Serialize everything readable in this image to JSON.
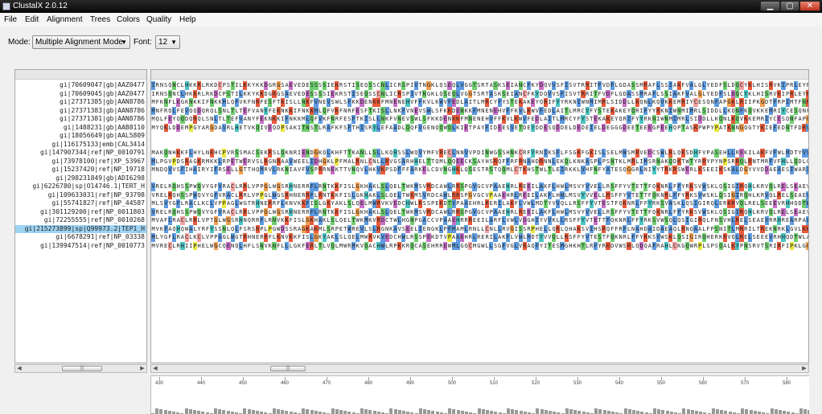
{
  "window": {
    "title": "ClustalX 2.0.12",
    "minimize": "▁",
    "maximize": "▢",
    "close": "✕"
  },
  "menu": [
    "File",
    "Edit",
    "Alignment",
    "Trees",
    "Colors",
    "Quality",
    "Help"
  ],
  "toolbar": {
    "mode_label": "Mode:",
    "mode_value": "Multiple Alignment Mode",
    "font_label": "Font:",
    "font_value": "12"
  },
  "sequence_names": [
    "gi|70609047|gb|AAZ0477",
    "gi|70609045|gb|AAZ0477",
    "gi|27371385|gb|AAN8786",
    "gi|27371383|gb|AAN8786",
    "gi|27371381|gb|AAN8786",
    "gi|1488231|gb|AAB8110",
    "gi|18056649|gb|AAL5809",
    "gi|116175133|emb|CAL3414",
    "gi|147907344|ref|NP_0010791",
    "gi|73978100|ref|XP_53967",
    "gi|15237420|ref|NP_19718",
    "gi|298231849|gb|ADI6298",
    "gi|6226780|sp|O14746.1|TERT_H",
    "gi|109633031|ref|NP_93798",
    "gi|55741827|ref|NP_44587",
    "gi|301129200|ref|NP_0011803",
    "gi|72255555|ref|NP_0010268",
    "gi|215273899|sp|Q99973.2|TEP1_H",
    "gi|6678291|ref|NP_03338",
    "gi|139947514|ref|NP_0010773"
  ],
  "selected_row": 17,
  "sequences": [
    "IRNSQNCLHKKRLRKDCPSTILKKYKKDGRGSAEVEDESSSSIEKRSTISEQSSCNLICRSPIVTNGKLQSEQLVGGTSRTASKSEIANCFKYDQVVSFISVTRRITFVDFLGDASSMRAFLSSIAKFVALGLYEDFSLDQCYKLHISRVKIPRLEYRAKHHSYLGRSQAIVNP",
    "IRNSQNCLHKKRLRKDCPSTILKKYKKDGRGSAEVEDESSSSIEKRSTISEQSSCNLICRSPIVTNGKLQSEQLVGGTSRTASKSEIANCFKYDQVVSFISVTRRITFVDFLGDASSMRAFLSSIAKFVALGLYEDFSLDQCYKLHISRVKIPRLEYRAKHHSYLGRSQAIVNP",
    "MFKNFLEGKNKKIFNKKMLQFVKFNRFESFTKISLLNKFVNEVSWLSFKKDENKKFMNENEHVFFKVLKWVFEDLAITLMRCYFYSTEKAKEYQRIFYYRKNIWNMIMRLSIDDLLKQNLKQVKKEMRIYCESQNFAPGKLRIIPKGDTFRPIMTFNRKIVNSDRKTTKLTT",
    "MNFRQLFEVQQDQRQLSNLTLTEFVANYFEKNKKIFNKKMLQFVKFNRFESFTKISLLNKFVNEVSWLSFKKDENKKFMNENEHVFFKVLKWVFEDLAITLMRCYFYSTEKAKEYQRIFYYRKNIWNMIMRLSIDDLLKQNFKQVKKEMRIYCESQNFAPGKLRIIPKGDTF",
    "MQLFEYQQDQRQLSNLTLTEFVANYFEKNKKIFNKKMLQFVKFNRFESFTKISLLNKFVNEVSWLSFKKDENKKFMNENEHVFFKVLKWVFEDLAITLMRCYFYSTEKAKEYQRIFYYRKNIWNMIMRLSIDDLLKQNLKQVKKEMRIYCESQNFAPGKLRIIPKGDTFRPIM",
    "MYQKLDDEMPGYARGDAVRLHETVKQIVEQDPSAKITNSTLRAFKFSFTHISRYLEFAADLQQFVGENQQWQLKIETPAYFIDEESVETDEYDDESQDDELDEDEIELDEGGGDEETEEEGPEEHQPTASKPWPYPATKNNGQGTYKIEFEDNTFDRVHKFLIFPLLVRAIV",
    "",
    "",
    "MAKQNHKKFLHYLNKHCPVRSSMACSEKRSLQKNRIENDGKQLKHFTTKANLLSLLKQHSSLWQVYMFVRECLNNVVPDINWGSSHNKCRFYRNIKSFLFSGKFGKISLSELMWSMRVEDCSWLRLQKSDHFVPASEHLLREKILAKFVFWLMDTYVVELLRSFFYITETTF",
    "MLPGVPDSRAGKRMKKLRPETWERVSLRGNRAAVWEELIDHGKLPFMALRNLCNLLRVGSARHHELTTQMLQQEECKSAYHSRQFFRFRNAHDRNNLEKQLKNKASPLPSNTKLMRLIMSRNAKQDKTWTYRRYPYNPSRRQLRNTMRFVFHLLQDLGYLLEAVLH",
    "MNDQVVSFIHAIRYIFRSELLGTTHQMRVLRKNIAVFVSPRRNEKTTVNQVLHKVKPSDFFFARKELCDVNGHKLQSESTRSTQQMLCTKHSTWLTLEIRKKLVHFNFYATESQGGRLNIYYTRKRSWERLKSEEIKSKALDGYVVDDAEAESIWARIEGGV",
    "",
    "VRELRQHSSPWQVYGFVRACLRRLVPPGLWGSRHNERRFLRNTKKFISLGKHAKLSLQELTWKMSVRDCAWLRRSPGVGCVPAAEHRLREEILAKFLHWLMSVYVVELLRSFFYVTETTFQKNRLFFYRKSVWSKLQSIGIRQHLKRVQLRELSEAEVRQHREARPALLTS",
    "VRELRQHSSPWQVYGFVRACLRRLVPPGLWGSRHNERRFLRNTKKFISLGKHAKLSLQELTWKMSVRDCAWLRRSPGVGCVPAAEHRLREEILAKFLHWLMSVYVVELLRSFFYVTETTFQKNRLFFYRKSVWSKLQSIGIRQHLKRVQLRELSEAEVRQHREARPALLTS",
    "MLSVYGFLRACLKCLVPPAGLWGTRHNERRFLKNVKKFISLGKYAKLSLQELMWRVKVEDCHWLRSSPEKDTVPAAEHRLRERILAKFLVWLMDTYVVQLLRSFFYVTESTFQKNRLFFYRKSVWSKLQSIGIRQLERKRVQLRELSEEEVRHHQDTWLAMPICRL",
    "VRELRQHSSPWQVYGFVRACLRRLVPPGLWGSRHNERRFLRNTKKFISLGKHAKLSLQELTWKMSVRDCAWLRRSPGVGCVPAAEHRLREEILAKFLHWLMSVYVVELLRSFFYVTETTFQKNRLFFYRKSVWSKLQSIGIRQHLKRVQLRELSEAEVRQHREARPALLTS",
    "MVAFLRACLRRLVPTGLWGSRHNQRRFLRNVKKFISLGKHAKLSLQELTWKMKVRDCTWLHGNPGACCVPAAEHRRREEILARFLVWLVDGHIYVVKLLRSFFYVTETTFQKNRLFFYRKSVWSQLQSIGIRQLFNSVHLRELSEAEVRRHREARPALLTSRLRFLPKPSG",
    "MVKFAQHQWALYRFYSSNLQLFSRSRPLPGWDSSRAGKAKMLSRPETWREVLSLRGNKAVSEELIENGKLPFMAMLRNLLCNLLRVGISSRPHELLQRLQHAKSVIHSRQFFRFLNAHDAIDAEAQLRNQAALFPSNITLMRRILTREKNRKLGVLKKPLGQFS",
    "MLYGFLRACLKCLVPPAGLWGTRHNERRFLKNVKKFISLGKYAKLSLQELMWRVKVEDCHWLRSSPEKDTVPAAEHRLRERILAKFLVWLMDTYVVQLLRSFFYVTESTFQKNRLFFYRKSVWSKLQSIGIRQHERKRVQLRELSEEEVRHHQDTWLAMPICRL",
    "MVRECLRHIIPHELWGCQENQLHFLSNVKNFLLLGKFERLTLVQLMWRMKVQACHWLRPKKRQCASEHRREWMLGQCMGWLLSGFVGLVRAQFYITESMGHKHTLRFYRKDVWSRLQDQAFRAHLCKGQWRPLSPSQALKYPNSRVTSRIRFIPKLGGLRLTAN"
  ],
  "ruler": {
    "ticks": [
      "430",
      "440",
      "450",
      "460",
      "470",
      "480",
      "490",
      "500",
      "510",
      "520",
      "530",
      "540",
      "550",
      "560",
      "570",
      "580",
      "590",
      "600"
    ]
  }
}
